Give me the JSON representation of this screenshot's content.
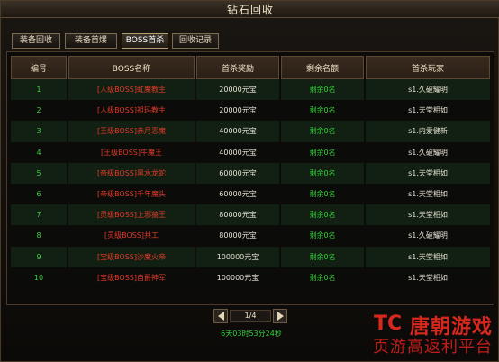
{
  "window": {
    "title": "钻石回收"
  },
  "tabs": [
    {
      "label": "装备回收"
    },
    {
      "label": "装备首爆"
    },
    {
      "label": "BOSS首杀"
    },
    {
      "label": "回收记录"
    }
  ],
  "table": {
    "headers": [
      "编号",
      "BOSS名称",
      "首杀奖励",
      "剩余名额",
      "首杀玩家"
    ],
    "rows": [
      [
        "1",
        "[人级BOSS]虹魔教主",
        "20000元宝",
        "剩余0名",
        "s1.久破耀明"
      ],
      [
        "2",
        "[人级BOSS]祖玛教主",
        "20000元宝",
        "剩余0名",
        "s1.天堂相如"
      ],
      [
        "3",
        "[王级BOSS]赤月恶魔",
        "40000元宝",
        "剩余0名",
        "s1.内爱健新"
      ],
      [
        "4",
        "[王级BOSS]牛魔王",
        "40000元宝",
        "剩余0名",
        "s1.久破耀明"
      ],
      [
        "5",
        "[帝级BOSS]黑水龙蛇",
        "60000元宝",
        "剩余0名",
        "s1.天堂相如"
      ],
      [
        "6",
        "[帝级BOSS]千年魔头",
        "60000元宝",
        "剩余0名",
        "s1.天堂相如"
      ],
      [
        "7",
        "[灵级BOSS]上邪猿王",
        "80000元宝",
        "剩余0名",
        "s1.天堂相如"
      ],
      [
        "8",
        "[灵级BOSS]共工",
        "80000元宝",
        "剩余0名",
        "s1.久破耀明"
      ],
      [
        "9",
        "[宝级BOSS]沙魔火帝",
        "100000元宝",
        "剩余0名",
        "s1.天堂相如"
      ],
      [
        "10",
        "[宝级BOSS]自爵神军",
        "100000元宝",
        "剩余0名",
        "s1.天堂相如"
      ]
    ]
  },
  "pager": {
    "page": "1/4"
  },
  "countdown": "6天03时53分24秒",
  "watermark": {
    "brand_mark": "TC",
    "line1": "唐朝游戏",
    "line2": "页游高返利平台"
  },
  "colors": {
    "player_green": "#36d23d",
    "boss_red": "#e13b2b",
    "brand_red": "#d7281d"
  }
}
